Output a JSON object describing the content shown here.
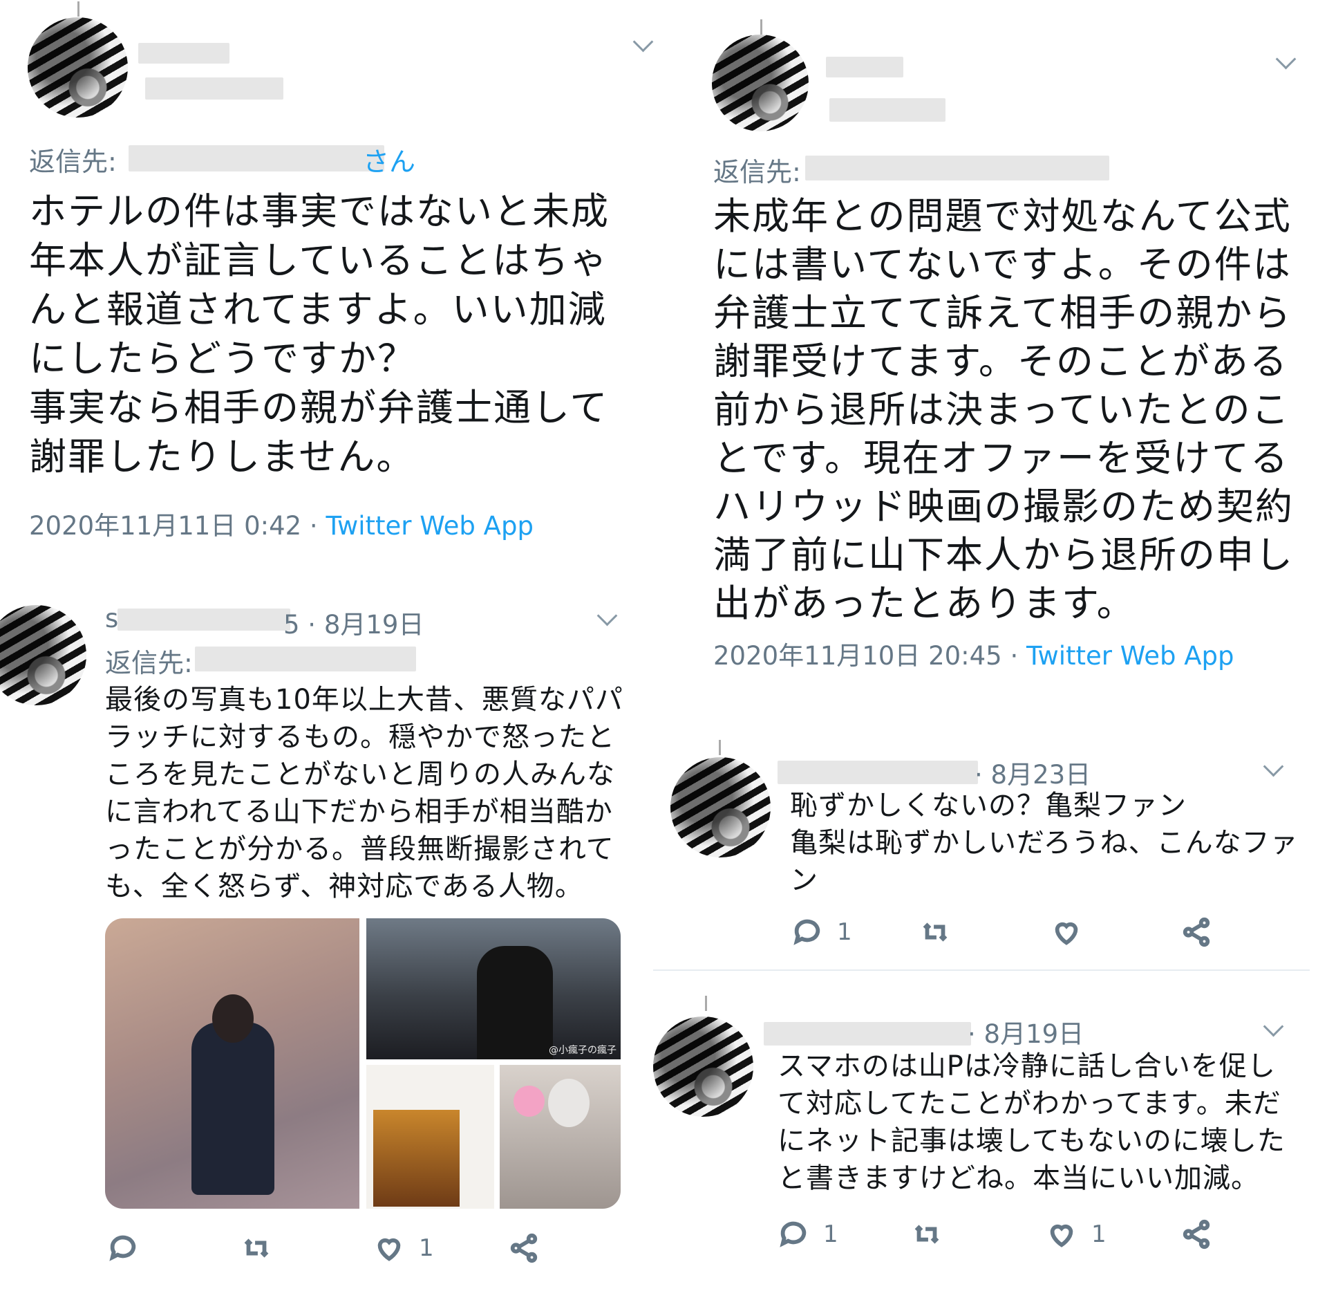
{
  "tweet_a": {
    "reply_label": "返信先:",
    "reply_suffix": "さん",
    "body": "ホテルの件は事実ではないと未成\n年本人が証言していることはちゃ\nんと報道されてますよ。いい加減\nにしたらどうですか？\n事実なら相手の親が弁護士通して\n謝罪したりしません。",
    "timestamp": "2020年11月11日 0:42 ·",
    "via": "Twitter Web App"
  },
  "tweet_b": {
    "name_partial": "s",
    "handle_partial": "5 · 8月19日",
    "reply_label": "返信先:",
    "body": "最後の写真も10年以上大昔、悪質なパパ\nラッチに対するもの。穏やかで怒ったと\nころを見たことがないと周りの人みんな\nに言われてる山下だから相手が相当酷か\nったことが分かる。普段無断撮影されて\nも、全く怒らず、神対応である人物。",
    "photo_credit": "@小瘋子の瘋子",
    "actions": {
      "reply": "",
      "retweet": "",
      "like": "1",
      "share": ""
    }
  },
  "tweet_c": {
    "reply_label": "返信先:",
    "body": "未成年との問題で対処なんて公式\nには書いてないですよ。その件は\n弁護士立てて訴えて相手の親から\n謝罪受けてます。そのことがある\n前から退所は決まっていたとのこ\nとです。現在オファーを受けてる\nハリウッド映画の撮影のため契約\n満了前に山下本人から退所の申し\n出があったとあります。",
    "timestamp": "2020年11月10日 20:45 ·",
    "via": "Twitter Web App"
  },
  "tweet_d": {
    "date": "· 8月23日",
    "body": "恥ずかしくないの？亀梨ファン\n亀梨は恥ずかしいだろうね、こんなファ\nン",
    "actions": {
      "reply": "1",
      "retweet": "",
      "like": "",
      "share": ""
    }
  },
  "tweet_e": {
    "date": "· 8月19日",
    "body": "スマホのは山Pは冷静に話し合いを促し\nて対応してたことがわかってます。未だ\nにネット記事は壊してもないのに壊した\nと書きますけどね。本当にいい加減。",
    "actions": {
      "reply": "1",
      "retweet": "",
      "like": "1",
      "share": ""
    }
  },
  "icons": [
    "chevron-down-icon",
    "reply-icon",
    "retweet-icon",
    "like-icon",
    "share-icon"
  ],
  "colors": {
    "link": "#1da1f2",
    "muted": "#657786",
    "text": "#14171a"
  }
}
